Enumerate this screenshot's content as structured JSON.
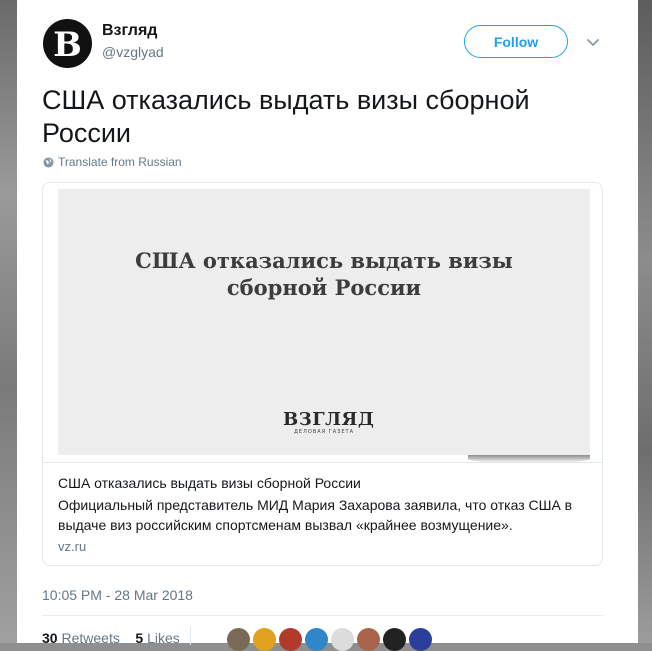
{
  "account": {
    "avatar_letter": "В",
    "name": "Взгляд",
    "handle": "@vzglyad",
    "follow_label": "Follow"
  },
  "tweet": {
    "text": "США отказались выдать визы сборной России",
    "translate_label": "Translate from Russian"
  },
  "link_card": {
    "preview_title_line1": "США отказались выдать визы",
    "preview_title_line2": "сборной России",
    "preview_logo": "ВЗГЛЯД",
    "preview_logo_sub": "ДЕЛОВАЯ ГАЗЕТА",
    "title": "США отказались выдать визы сборной России",
    "description": "Официальный представитель МИД Мария Захарова заявила, что отказ США в выдаче виз российским спортсменам вызвал «крайнее возмущение».",
    "domain": "vz.ru"
  },
  "timestamp": "10:05 PM - 28 Mar 2018",
  "stats": {
    "retweets_count": "30",
    "retweets_label": "Retweets",
    "likes_count": "5",
    "likes_label": "Likes"
  },
  "likers": [
    {
      "color": "#7a6a55"
    },
    {
      "color": "#e0a020"
    },
    {
      "color": "#b23a2a"
    },
    {
      "color": "#2f86c9"
    },
    {
      "color": "#dcdcdc"
    },
    {
      "color": "#a8634a"
    },
    {
      "color": "#222222"
    },
    {
      "color": "#2a3f9a"
    }
  ],
  "colors": {
    "accent": "#1da1f2",
    "text": "#14171a",
    "muted": "#657786"
  }
}
